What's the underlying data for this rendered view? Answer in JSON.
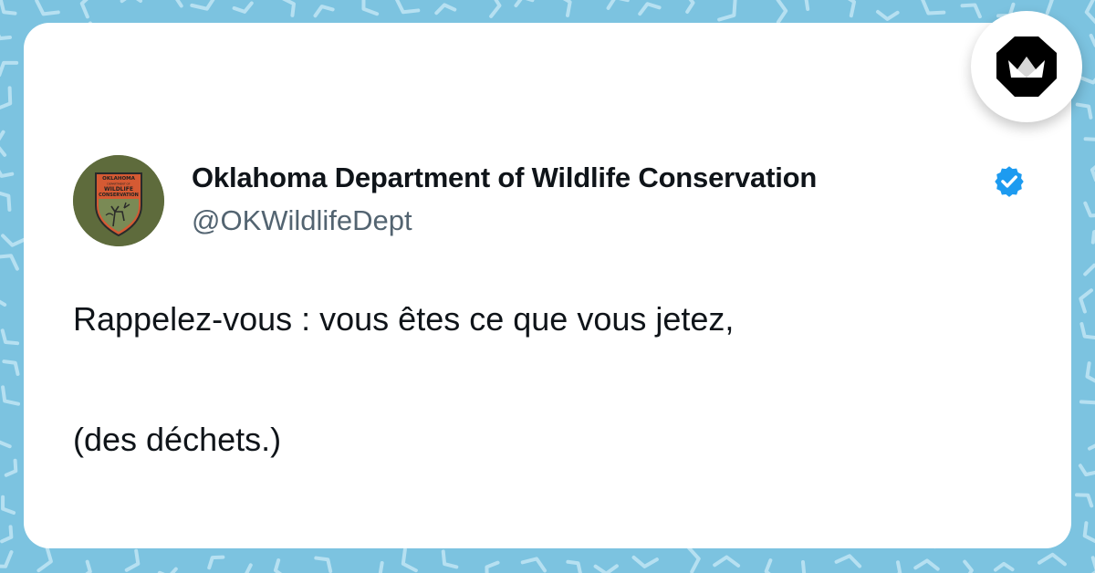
{
  "tweet": {
    "author_name": "Oklahoma Department of Wildlife Conservation",
    "handle": "@OKWildlifeDept",
    "verified": true,
    "text_lines": [
      "Rappelez-vous : vous êtes ce que vous jetez,",
      "(des déchets.)"
    ],
    "avatar": {
      "icon": "wildlife-department-logo",
      "logo_text": [
        "OKLAHOMA",
        "DEPARTMENT OF",
        "WILDLIFE",
        "CONSERVATION"
      ]
    }
  },
  "branding": {
    "icon": "crown-logo"
  },
  "colors": {
    "background": "#7cc3e0",
    "pattern": "#b6e0f1",
    "card": "#ffffff",
    "name_text": "#0f1419",
    "handle_text": "#536471",
    "verified_badge": "#1d9bf0",
    "avatar_green": "#5e6b3c",
    "logo_orange": "#d55a33"
  }
}
